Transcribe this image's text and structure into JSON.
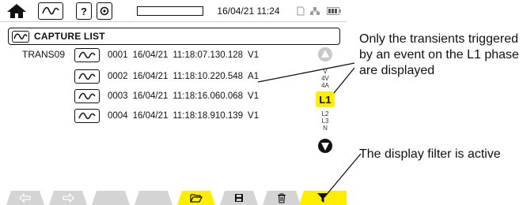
{
  "status_bar": {
    "date_time": "16/04/21 11:24",
    "icons": [
      "home-icon",
      "waveform-icon",
      "help-icon",
      "camera-icon",
      "sd-card-icon",
      "network-icon",
      "battery-icon"
    ],
    "help_glyph": "?"
  },
  "page": {
    "title": "CAPTURE LIST",
    "group_label": "TRANS09"
  },
  "captures": [
    {
      "number": "0001",
      "date": "16/04/21",
      "time": "11:18:07.130.128",
      "channel": "V1"
    },
    {
      "number": "0002",
      "date": "16/04/21",
      "time": "11:18:10.220.548",
      "channel": "A1"
    },
    {
      "number": "0003",
      "date": "16/04/21",
      "time": "11:18:16.060.068",
      "channel": "V1"
    },
    {
      "number": "0004",
      "date": "16/04/21",
      "time": "11:18:18.910.139",
      "channel": "V1"
    }
  ],
  "filter_panel": {
    "options_top": [
      "V",
      "4V",
      "4A"
    ],
    "selected": "L1",
    "options_bottom": [
      "L2",
      "L3",
      "N"
    ]
  },
  "function_keys": [
    {
      "icon": "previous-page-icon",
      "state": "inactive"
    },
    {
      "icon": "next-page-icon",
      "state": "inactive"
    },
    {
      "icon": "empty",
      "state": "inactive"
    },
    {
      "icon": "empty",
      "state": "inactive"
    },
    {
      "icon": "open-folder-icon",
      "state": "active"
    },
    {
      "icon": "save-icon",
      "state": "inactive"
    },
    {
      "icon": "delete-icon",
      "state": "inactive"
    },
    {
      "icon": "filter-icon",
      "state": "active"
    }
  ],
  "annotations": {
    "filter_note": "Only the transients triggered by an event on the L1 phase are displayed",
    "filter_active_note": "The display filter is active"
  },
  "colors": {
    "accent_yellow": "#ffee00",
    "key_grey": "#d4d4d4",
    "text": "#111111"
  }
}
